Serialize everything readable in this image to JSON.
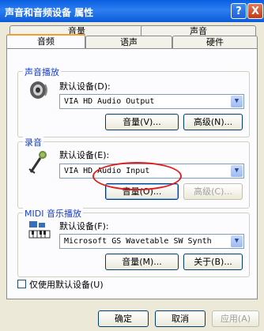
{
  "window": {
    "title": "声音和音频设备 属性"
  },
  "title_buttons": {
    "help": "?",
    "close": "X"
  },
  "tabs_back": [
    "音量",
    "声音"
  ],
  "tabs_front": [
    "音频",
    "语声",
    "硬件"
  ],
  "sound_playback": {
    "group_title": "声音播放",
    "default_label": "默认设备(D):",
    "device": "VIA HD Audio Output",
    "volume_button": "音量(V)...",
    "advanced_button": "高级(N)..."
  },
  "recording": {
    "group_title": "录音",
    "default_label": "默认设备(E):",
    "device": "VIA HD Audio Input",
    "volume_button": "音量(O)...",
    "advanced_button": "高级(C)..."
  },
  "midi": {
    "group_title": "MIDI 音乐播放",
    "default_label": "默认设备(F):",
    "device": "Microsoft GS Wavetable SW Synth",
    "volume_button": "音量(M)...",
    "about_button": "关于(B)..."
  },
  "use_default_checkbox": {
    "label": "仅使用默认设备(U)",
    "checked": false
  },
  "footer": {
    "ok": "确定",
    "cancel": "取消",
    "apply": "应用(A)"
  },
  "icons": {
    "speaker": "speaker-icon",
    "microphone": "microphone-icon",
    "midi": "midi-keyboard-icon",
    "dropdown": "chevron-down-icon"
  },
  "colors": {
    "titlebar": "#0a5fe0",
    "group_title": "#1a40c8",
    "annotation": "#e0201e"
  }
}
